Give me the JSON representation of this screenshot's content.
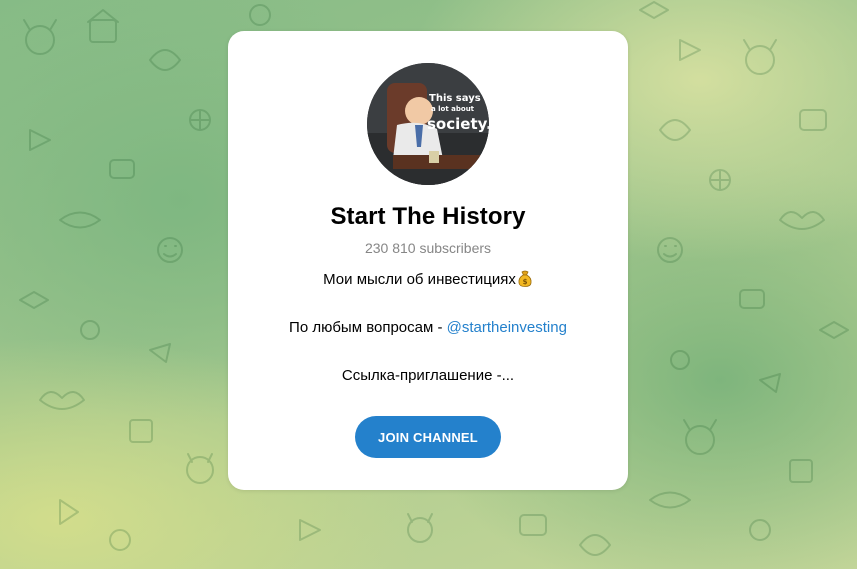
{
  "channel": {
    "name": "Start The History",
    "subscribers": "230 810 subscribers",
    "avatar_text": [
      "This says",
      "a lot about",
      "society."
    ]
  },
  "description": {
    "line1": "Мои мысли об инвестициях",
    "line1_emoji": "money-bag-icon",
    "line2_prefix": "По любым вопросам - ",
    "line2_link": "@startheinvesting",
    "line3": "Ссылка-приглашение -..."
  },
  "actions": {
    "join_label": "JOIN CHANNEL"
  },
  "colors": {
    "accent": "#2481cc",
    "subtitle": "#868686",
    "card": "#ffffff"
  }
}
